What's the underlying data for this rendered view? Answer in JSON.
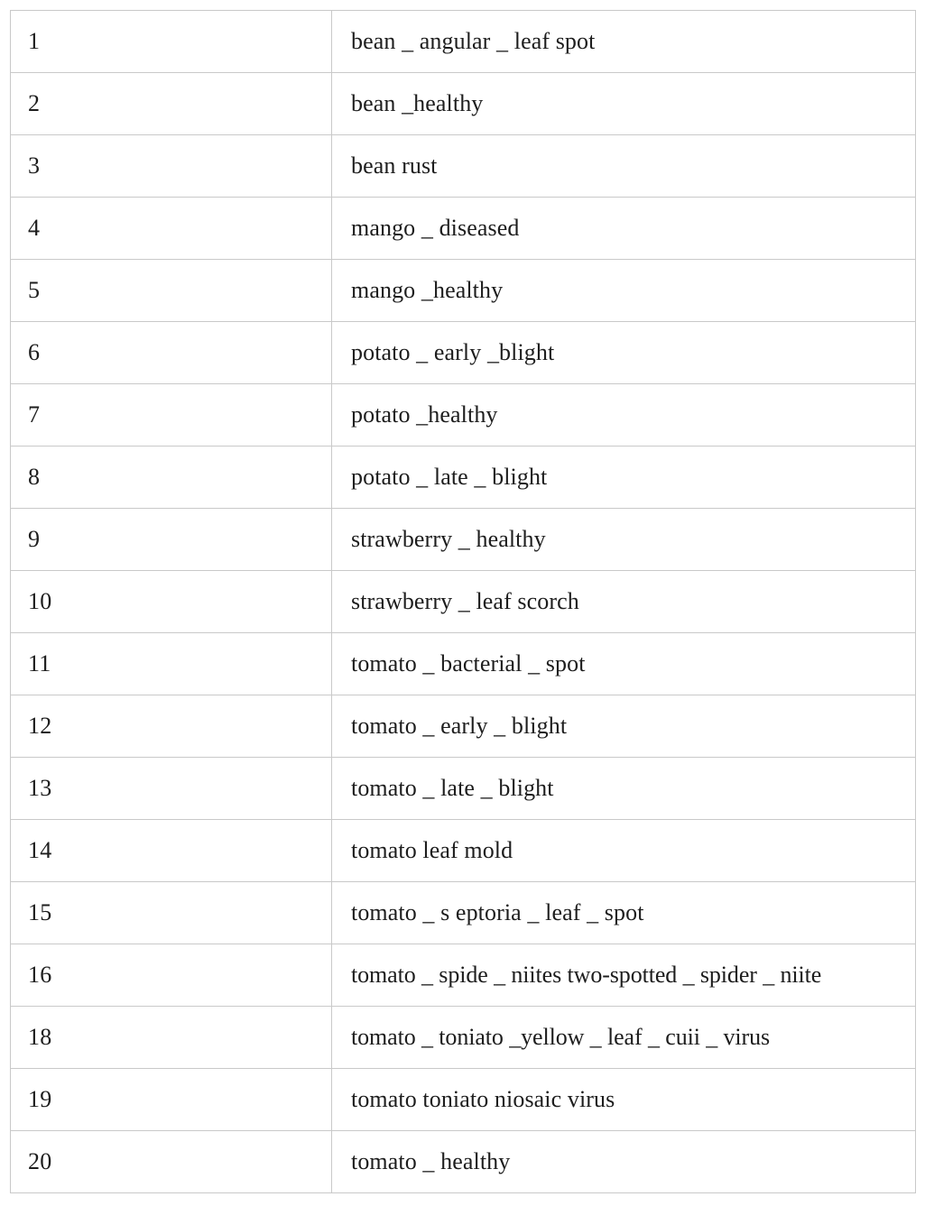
{
  "document": {
    "kind": "table",
    "background_color": "#ffffff",
    "border_color": "#c9c9c9",
    "text_color": "#1d1d1d"
  },
  "table": {
    "name": "class-label-table",
    "column_count": 2,
    "row_count": 19,
    "columns": [
      {
        "key": "index",
        "header": ""
      },
      {
        "key": "label",
        "header": ""
      }
    ],
    "rows": [
      {
        "index": "1",
        "label": "bean _ angular _ leaf spot"
      },
      {
        "index": "2",
        "label": "bean _healthy"
      },
      {
        "index": "3",
        "label": "bean rust"
      },
      {
        "index": "4",
        "label": "mango _ diseased"
      },
      {
        "index": "5",
        "label": "mango _healthy"
      },
      {
        "index": "6",
        "label": "potato _ early _blight"
      },
      {
        "index": "7",
        "label": "potato _healthy"
      },
      {
        "index": "8",
        "label": "potato _ late _ blight"
      },
      {
        "index": "9",
        "label": "strawberry _ healthy"
      },
      {
        "index": "10",
        "label": "strawberry _ leaf scorch"
      },
      {
        "index": "11",
        "label": "tomato _ bacterial _ spot"
      },
      {
        "index": "12",
        "label": "tomato _ early _ blight"
      },
      {
        "index": "13",
        "label": "tomato _ late _ blight"
      },
      {
        "index": "14",
        "label": "tomato leaf mold"
      },
      {
        "index": "15",
        "label": "tomato _ s eptoria _ leaf _ spot"
      },
      {
        "index": "16",
        "label": "tomato _ spide _ niites two-spotted _ spider _ niite"
      },
      {
        "index": "18",
        "label": "tomato _ toniato _yellow _ leaf _ cuii _ virus"
      },
      {
        "index": "19",
        "label": "tomato toniato niosaic virus"
      },
      {
        "index": "20",
        "label": "tomato _ healthy"
      }
    ]
  }
}
